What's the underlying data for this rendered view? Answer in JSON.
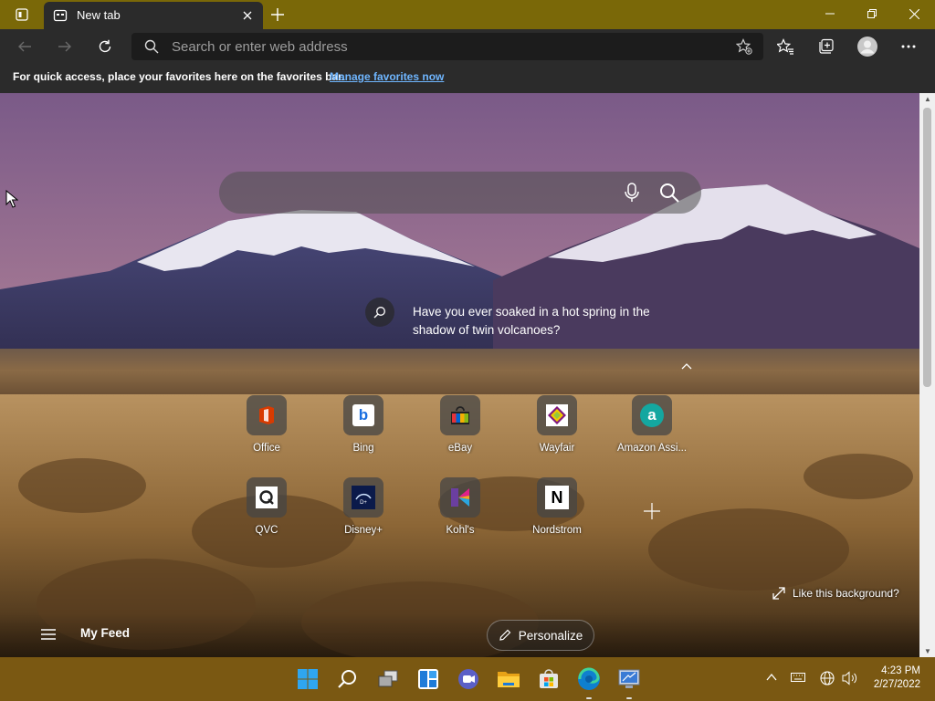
{
  "browser": {
    "tab_title": "New tab",
    "address_placeholder": "Search or enter web address",
    "favorites_bar_message": "For quick access, place your favorites here on the favorites bar.",
    "favorites_bar_link": "Manage favorites now"
  },
  "ntp": {
    "search_placeholder": "",
    "background_info": "Have you ever soaked in a hot spring in the shadow of twin volcanoes?",
    "like_background": "Like this background?",
    "my_feed": "My Feed",
    "personalize": "Personalize",
    "tiles": [
      {
        "label": "Office",
        "icon": "office-icon"
      },
      {
        "label": "Bing",
        "icon": "bing-icon"
      },
      {
        "label": "eBay",
        "icon": "ebay-icon"
      },
      {
        "label": "Wayfair",
        "icon": "wayfair-icon"
      },
      {
        "label": "Amazon Assi...",
        "icon": "amazon-assistant-icon"
      },
      {
        "label": "QVC",
        "icon": "qvc-icon"
      },
      {
        "label": "Disney+",
        "icon": "disney-plus-icon"
      },
      {
        "label": "Kohl's",
        "icon": "kohls-icon"
      },
      {
        "label": "Nordstrom",
        "icon": "nordstrom-icon"
      }
    ]
  },
  "taskbar": {
    "time": "4:23 PM",
    "date": "2/27/2022"
  },
  "colors": {
    "title_bar": "#7a6808",
    "toolbar": "#2b2b2b",
    "taskbar": "#7a5812",
    "link": "#6fb6ff"
  }
}
